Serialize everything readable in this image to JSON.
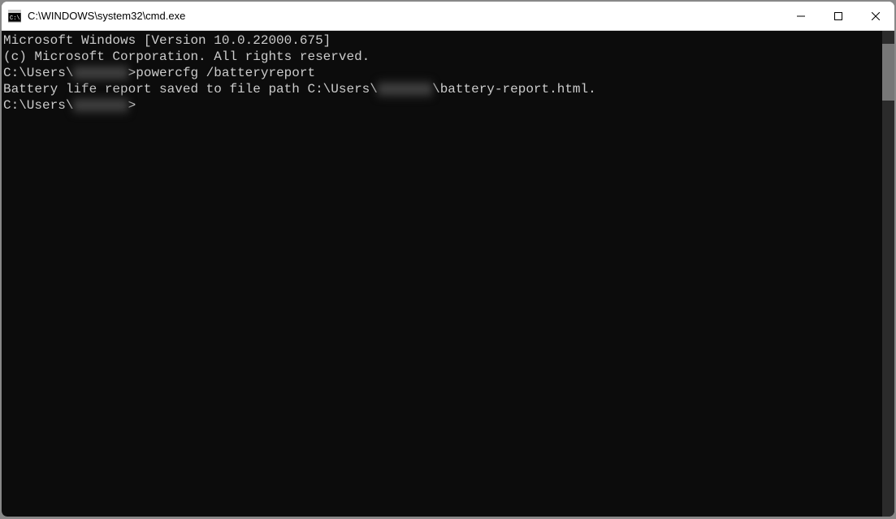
{
  "window": {
    "title": "C:\\WINDOWS\\system32\\cmd.exe"
  },
  "terminal": {
    "header1": "Microsoft Windows [Version 10.0.22000.675]",
    "header2": "(c) Microsoft Corporation. All rights reserved.",
    "blank1": "",
    "prompt1_prefix": "C:\\Users\\",
    "prompt1_user_blur": "xxxxxxx",
    "prompt1_cmd": ">powercfg /batteryreport",
    "output_prefix": "Battery life report saved to file path C:\\Users\\",
    "output_user_blur": "xxxxxxx",
    "output_suffix": "\\battery-report.html.",
    "blank2": "",
    "prompt2_prefix": "C:\\Users\\",
    "prompt2_user_blur": "xxxxxxx",
    "prompt2_suffix": ">"
  }
}
